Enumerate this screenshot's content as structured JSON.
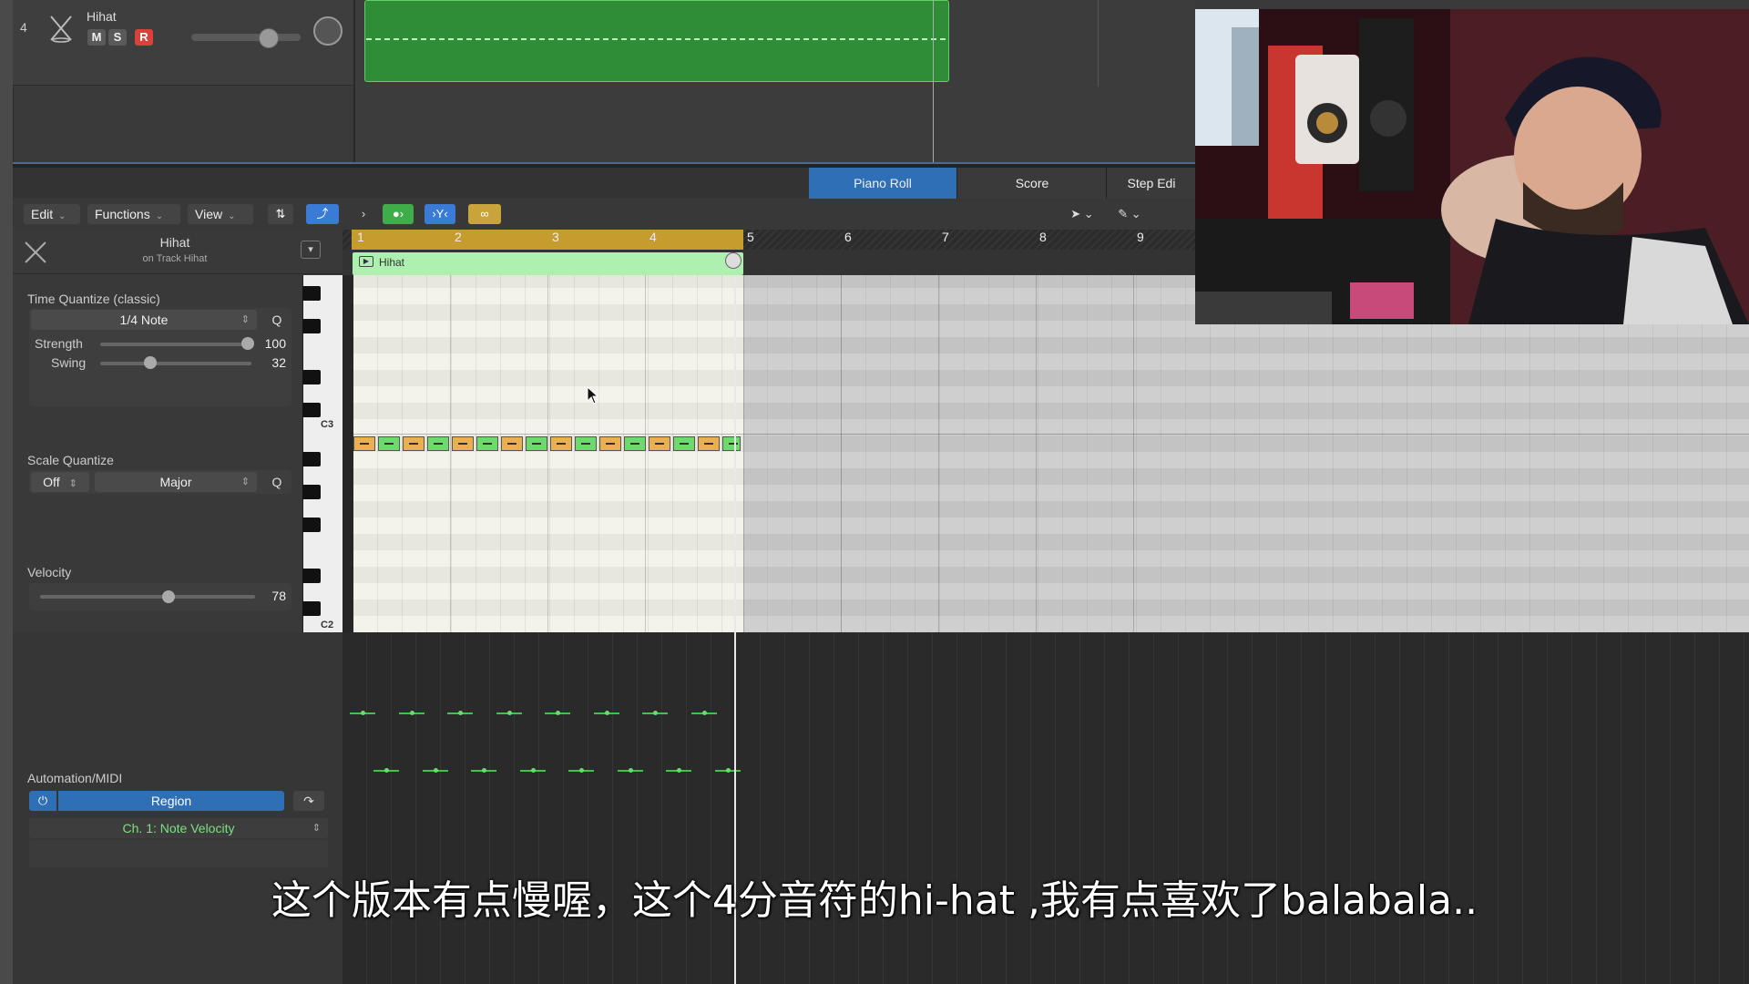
{
  "track": {
    "number": "4",
    "name": "Hihat",
    "mute_label": "M",
    "solo_label": "S",
    "record_label": "R"
  },
  "tabs": {
    "piano_roll": "Piano Roll",
    "score": "Score",
    "step_editor": "Step Edi"
  },
  "toolbar": {
    "edit": "Edit",
    "functions": "Functions",
    "view": "View"
  },
  "inspector": {
    "region_name": "Hihat",
    "region_sub": "on Track Hihat",
    "time_quantize": {
      "label": "Time Quantize (classic)",
      "value": "1/4 Note",
      "q_label": "Q",
      "strength_label": "Strength",
      "strength_value": "100",
      "swing_label": "Swing",
      "swing_value": "32"
    },
    "scale_quantize": {
      "label": "Scale Quantize",
      "root": "Off",
      "scale": "Major",
      "q_label": "Q"
    },
    "velocity": {
      "label": "Velocity",
      "value": "78"
    }
  },
  "keyboard": {
    "c3_label": "C3",
    "c2_label": "C2"
  },
  "ruler": {
    "bars": [
      "1",
      "2",
      "3",
      "4",
      "5",
      "6",
      "7",
      "8",
      "9"
    ]
  },
  "region": {
    "name": "Hihat"
  },
  "automation": {
    "label": "Automation/MIDI",
    "mode": "Region",
    "parameter": "Ch. 1: Note Velocity"
  },
  "subtitle": "这个版本有点慢喔，这个4分音符的hi-hat ,我有点喜欢了balabala..",
  "colors": {
    "region_green": "#2f8c37",
    "note_orange": "#e8b04e",
    "note_green": "#6fd86f",
    "selected_tab": "#2f6fb6",
    "cycle_yellow": "#c79c2e"
  }
}
